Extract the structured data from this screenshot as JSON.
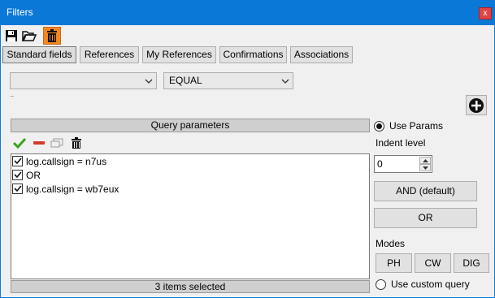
{
  "window": {
    "title": "Filters",
    "close_label": "x"
  },
  "toolbar": {
    "save_icon": "save-icon",
    "open_icon": "folder-open-icon",
    "delete_icon": "trash-icon",
    "delete_active_color": "#f5861f"
  },
  "tabs": [
    {
      "label": "Standard fields",
      "active": true
    },
    {
      "label": "References",
      "active": false
    },
    {
      "label": "My References",
      "active": false
    },
    {
      "label": "Confirmations",
      "active": false
    },
    {
      "label": "Associations",
      "active": false
    }
  ],
  "filter": {
    "field_value": "",
    "operator_value": "EQUAL",
    "add_icon": "plus-circle-icon"
  },
  "query": {
    "header": "Query parameters",
    "tools": [
      "check-icon",
      "minus-icon",
      "window-icon",
      "trash-icon"
    ],
    "items": [
      {
        "checked": true,
        "text": "log.callsign = n7us"
      },
      {
        "checked": true,
        "text": "OR"
      },
      {
        "checked": true,
        "text": "log.callsign = wb7eux"
      }
    ],
    "footer": "3 items selected"
  },
  "side": {
    "use_params_label": "Use Params",
    "use_params_selected": true,
    "indent_label": "Indent level",
    "indent_value": "0",
    "and_button": "AND (default)",
    "or_button": "OR",
    "modes_label": "Modes",
    "modes": [
      "PH",
      "CW",
      "DIG"
    ],
    "custom_query_label": "Use custom query",
    "custom_query_selected": false
  }
}
